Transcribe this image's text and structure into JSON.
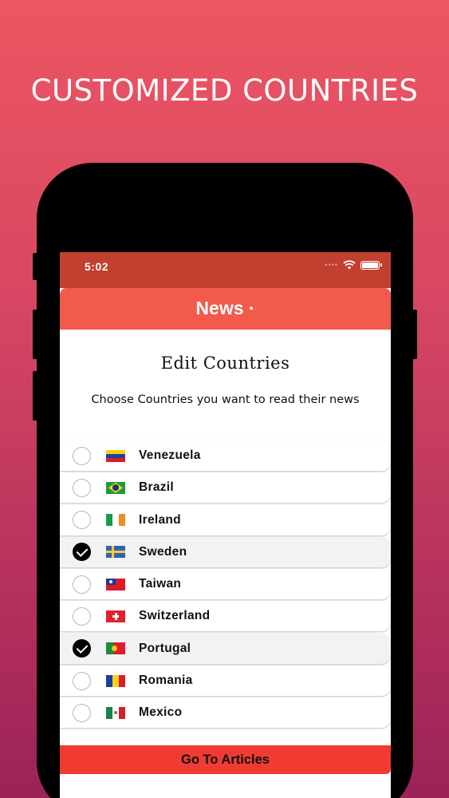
{
  "headline": "CUSTOMIZED COUNTRIES",
  "status_bar": {
    "time": "5:02"
  },
  "nav": {
    "title": "News ·"
  },
  "page": {
    "title": "Edit Countries",
    "subtitle": "Choose Countries you want to read their news"
  },
  "countries": [
    {
      "name": "Venezuela",
      "flag": "venezuela-flag-icon",
      "checked": false
    },
    {
      "name": "Brazil",
      "flag": "brazil-flag-icon",
      "checked": false
    },
    {
      "name": "Ireland",
      "flag": "ireland-flag-icon",
      "checked": false
    },
    {
      "name": "Sweden",
      "flag": "sweden-flag-icon",
      "checked": true
    },
    {
      "name": "Taiwan",
      "flag": "taiwan-flag-icon",
      "checked": false
    },
    {
      "name": "Switzerland",
      "flag": "switzerland-flag-icon",
      "checked": false
    },
    {
      "name": "Portugal",
      "flag": "portugal-flag-icon",
      "checked": true
    },
    {
      "name": "Romania",
      "flag": "romania-flag-icon",
      "checked": false
    },
    {
      "name": "Mexico",
      "flag": "mexico-flag-icon",
      "checked": false
    }
  ],
  "go_button": {
    "label": "Go To Articles"
  },
  "colors": {
    "background_top": "#ec5663",
    "background_bottom": "#9c2257",
    "status_bar": "#c2402f",
    "nav_bar": "#f25a4c",
    "go_button": "#f13b32"
  }
}
